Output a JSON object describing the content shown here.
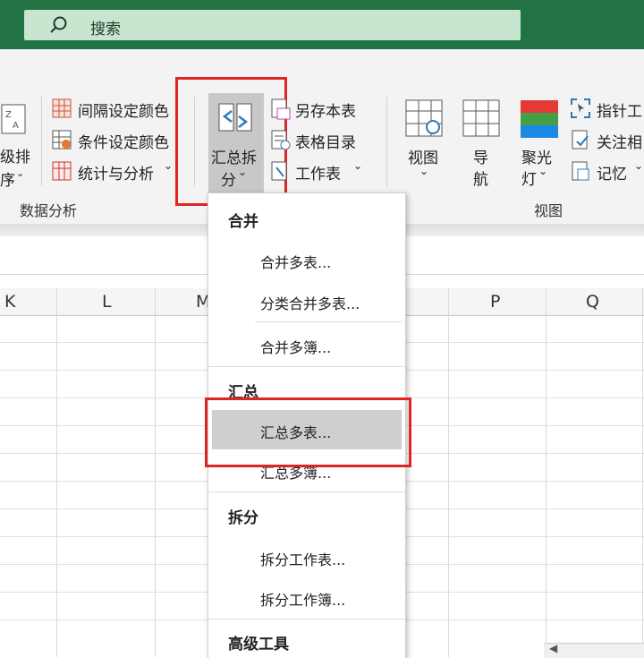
{
  "search": {
    "label": "搜索"
  },
  "ribbon": {
    "left_partial": {
      "line1": "级排",
      "line2": "序"
    },
    "analysis_items": [
      "间隔设定颜色",
      "条件设定颜色",
      "统计与分析"
    ],
    "analysis_group_label": "数据分析",
    "summary_button": {
      "line1": "汇总拆",
      "line2": "分"
    },
    "sheet_items": [
      "另存本表",
      "表格目录",
      "工作表"
    ],
    "view_buttons": [
      {
        "line1": "视图",
        "line2": ""
      },
      {
        "line1": "导",
        "line2": "航"
      },
      {
        "line1": "聚光",
        "line2": "灯"
      }
    ],
    "right_items": [
      "指针工",
      "关注相",
      "记忆"
    ],
    "view_group_label": "视图"
  },
  "columns": [
    "K",
    "L",
    "M",
    "P",
    "Q"
  ],
  "menu": {
    "sections": [
      {
        "header": "合并",
        "items": [
          "合并多表...",
          "分类合并多表...",
          "合并多簿..."
        ]
      },
      {
        "header": "汇总",
        "items": [
          "汇总多表...",
          "汇总多簿..."
        ]
      },
      {
        "header": "拆分",
        "items": [
          "拆分工作表...",
          "拆分工作簿..."
        ]
      },
      {
        "header": "高级工具",
        "items": []
      }
    ],
    "highlighted_item": "汇总多表..."
  },
  "colors": {
    "titlebar": "#217346",
    "search_bg": "#c8e6cf",
    "highlight_box": "#e02424",
    "hover": "#cfcfcf"
  }
}
